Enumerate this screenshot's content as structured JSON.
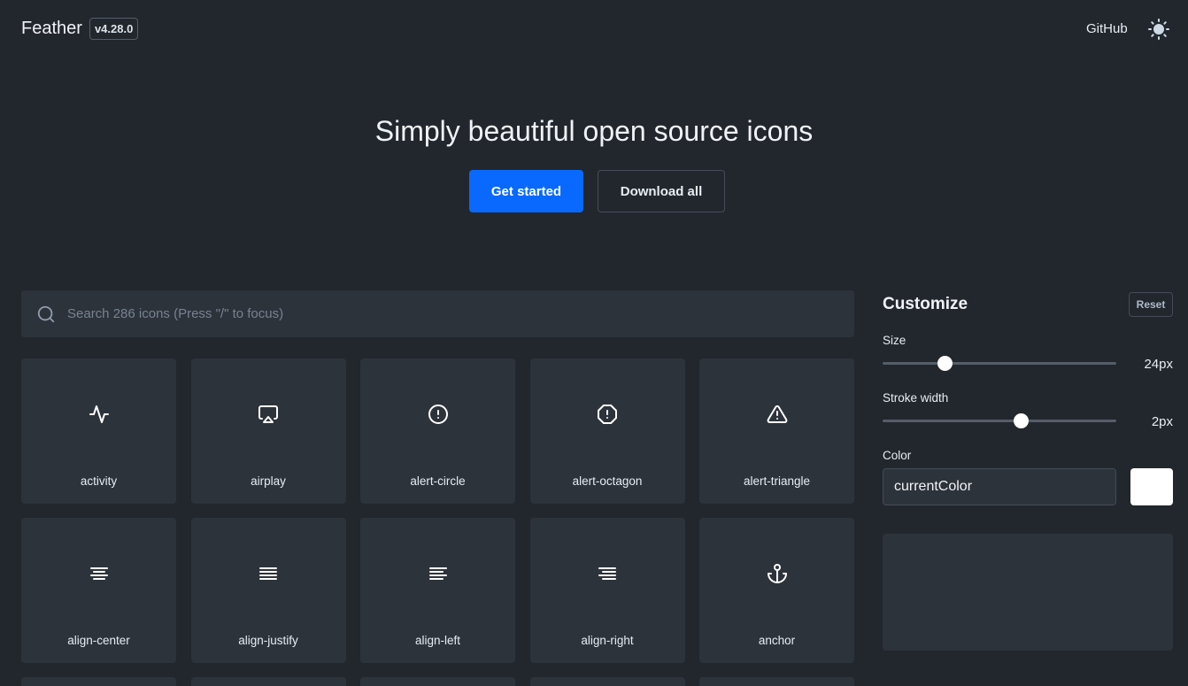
{
  "header": {
    "brand": "Feather",
    "version": "v4.28.0",
    "github_label": "GitHub",
    "theme_icon": "sun-icon"
  },
  "hero": {
    "title": "Simply beautiful open source icons",
    "primary_button": "Get started",
    "secondary_button": "Download all"
  },
  "search": {
    "placeholder": "Search 286 icons (Press \"/\" to focus)",
    "value": ""
  },
  "icons": [
    {
      "name": "activity"
    },
    {
      "name": "airplay"
    },
    {
      "name": "alert-circle"
    },
    {
      "name": "alert-octagon"
    },
    {
      "name": "alert-triangle"
    },
    {
      "name": "align-center"
    },
    {
      "name": "align-justify"
    },
    {
      "name": "align-left"
    },
    {
      "name": "align-right"
    },
    {
      "name": "anchor"
    }
  ],
  "customize": {
    "title": "Customize",
    "reset_label": "Reset",
    "size": {
      "label": "Size",
      "value": 24,
      "display": "24px",
      "min": 16,
      "max": 48
    },
    "stroke": {
      "label": "Stroke width",
      "value": 2,
      "display": "2px",
      "min": 0.5,
      "max": 3
    },
    "color": {
      "label": "Color",
      "value": "currentColor",
      "swatch": "#ffffff"
    }
  },
  "colors": {
    "background": "#22272e",
    "surface": "#2d333b",
    "accent": "#0969ff",
    "text": "#e6edf3"
  }
}
